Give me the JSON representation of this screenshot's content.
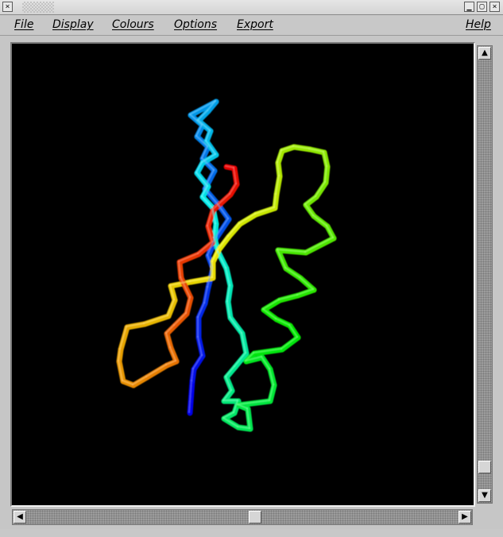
{
  "window": {
    "close_glyph": "×",
    "minimize_glyph": "▁",
    "maximize_glyph": "▢"
  },
  "menu": {
    "file": "File",
    "display": "Display",
    "colours": "Colours",
    "options": "Options",
    "export": "Export",
    "help": "Help"
  },
  "viewer": {
    "background": "#000000",
    "rendering": "protein backbone trace, rainbow coloured N-terminus (blue) to C-terminus (red)"
  },
  "scrollbars": {
    "vertical_position": 0.95,
    "horizontal_position": 0.5
  }
}
